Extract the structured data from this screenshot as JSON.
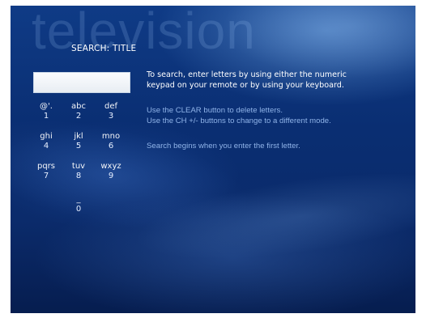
{
  "watermark": "television",
  "page_title": "SEARCH: TITLE",
  "search": {
    "value": "",
    "placeholder": ""
  },
  "keypad": {
    "keys": [
      {
        "letters": "@'.",
        "digit": "1"
      },
      {
        "letters": "abc",
        "digit": "2"
      },
      {
        "letters": "def",
        "digit": "3"
      },
      {
        "letters": "ghi",
        "digit": "4"
      },
      {
        "letters": "jkl",
        "digit": "5"
      },
      {
        "letters": "mno",
        "digit": "6"
      },
      {
        "letters": "pqrs",
        "digit": "7"
      },
      {
        "letters": "tuv",
        "digit": "8"
      },
      {
        "letters": "wxyz",
        "digit": "9"
      },
      {
        "letters": "_",
        "digit": "0"
      }
    ]
  },
  "instructions": {
    "primary_line1": "To search, enter letters by using either the numeric",
    "primary_line2": "keypad on your remote or by using your keyboard.",
    "clear_line": "Use the CLEAR button to delete letters.",
    "mode_line": "Use the CH +/- buttons to change to a different mode.",
    "begin_line": "Search begins when you enter the first letter."
  },
  "colors": {
    "background": "#0b2b6b",
    "primary_text": "#ffffff",
    "secondary_text": "#8fb3e8"
  }
}
